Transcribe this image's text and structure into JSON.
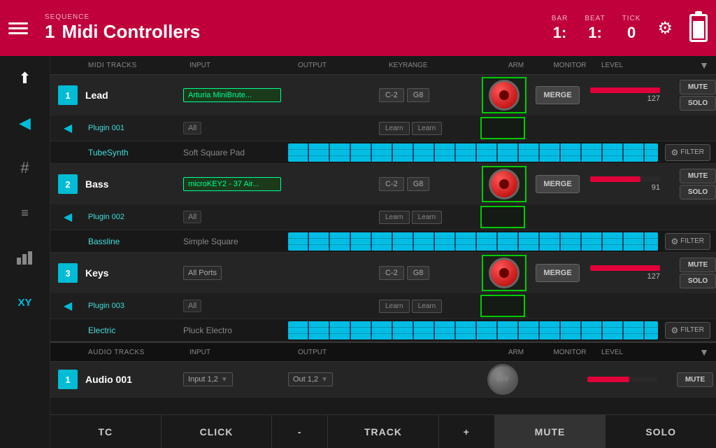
{
  "app": {
    "title": "Midi Controllers",
    "sequence_label": "SEQUENCE",
    "sequence_number": "1"
  },
  "transport": {
    "bar_label": "BAR",
    "bar_value": "1:",
    "beat_label": "BEAT",
    "beat_value": "1:",
    "tick_label": "TICK",
    "tick_value": "0"
  },
  "midi_tracks_header": {
    "col1": "MIDI TRACKS",
    "col2": "INPUT",
    "col3": "OUTPUT",
    "col4": "KEYRANGE",
    "col5": "ARM",
    "col6": "MONITOR",
    "col7": "LEVEL"
  },
  "midi_tracks": [
    {
      "number": "1",
      "name": "Lead",
      "input": "Arturia MiniBrute...",
      "output": "",
      "keyrange_low": "C-2",
      "keyrange_high": "G8",
      "plugin": "Plugin 001",
      "plugin_input": "All",
      "instrument": "TubeSynth",
      "preset": "Soft Square Pad",
      "level_value": "127",
      "level_pct": 100
    },
    {
      "number": "2",
      "name": "Bass",
      "input": "microKEY2 - 37 Air...",
      "output": "",
      "keyrange_low": "C-2",
      "keyrange_high": "G8",
      "plugin": "Plugin 002",
      "plugin_input": "All",
      "instrument": "Bassline",
      "preset": "Simple Square",
      "level_value": "91",
      "level_pct": 72
    },
    {
      "number": "3",
      "name": "Keys",
      "input": "All Ports",
      "output": "",
      "keyrange_low": "C-2",
      "keyrange_high": "G8",
      "plugin": "Plugin 003",
      "plugin_input": "All",
      "instrument": "Electric",
      "preset": "Pluck Electro",
      "level_value": "127",
      "level_pct": 100
    }
  ],
  "audio_tracks_header": {
    "col1": "AUDIO TRACKS",
    "col2": "INPUT",
    "col3": "OUTPUT",
    "col4": "ARM",
    "col5": "MONITOR",
    "col6": "LEVEL"
  },
  "audio_tracks": [
    {
      "number": "1",
      "name": "Audio 001",
      "input": "Input 1,2",
      "output": "Out 1,2"
    }
  ],
  "buttons": {
    "merge": "MERGE",
    "mute": "MUTE",
    "solo": "SOLO",
    "filter": "FILTER",
    "learn": "Learn"
  },
  "toolbar": {
    "tc": "TC",
    "click": "CLICK",
    "minus": "-",
    "track": "TRACK",
    "plus": "+",
    "mute": "MUTE",
    "solo": "SOLO"
  }
}
